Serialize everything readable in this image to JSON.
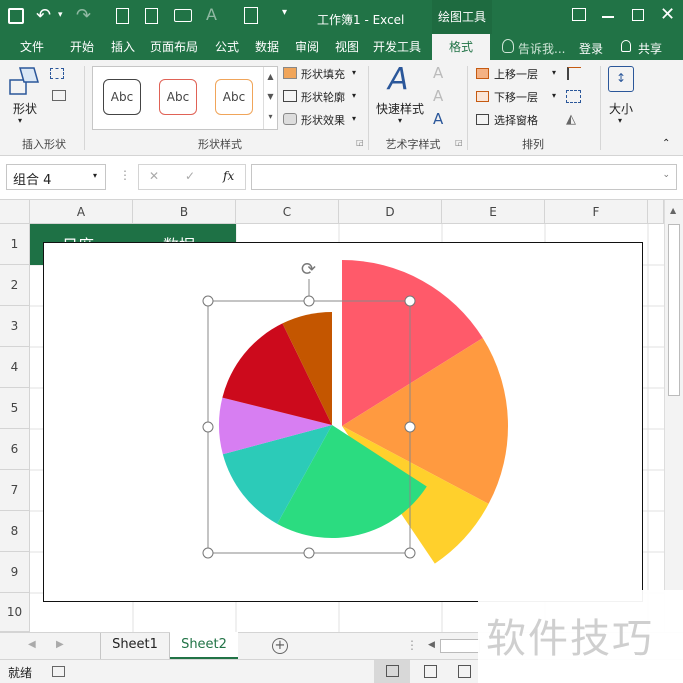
{
  "titlebar": {
    "title": "工作簿1 - Excel",
    "context_tab": "绘图工具"
  },
  "tabs": [
    "文件",
    "开始",
    "插入",
    "页面布局",
    "公式",
    "数据",
    "审阅",
    "视图",
    "开发工具",
    "格式"
  ],
  "tell_me": "告诉我...",
  "login": "登录",
  "share": "共享",
  "ribbon": {
    "insert_shapes": {
      "shape_label": "形状",
      "group": "插入形状"
    },
    "shape_styles": {
      "samples": [
        "Abc",
        "Abc",
        "Abc"
      ],
      "fill": "形状填充",
      "outline": "形状轮廓",
      "effect": "形状效果",
      "group": "形状样式"
    },
    "wordart": {
      "quick": "快速样式",
      "group": "艺术字样式"
    },
    "arrange": {
      "forward": "上移一层",
      "backward": "下移一层",
      "pane": "选择窗格",
      "group": "排列"
    },
    "size": {
      "label": "大小"
    }
  },
  "formula_bar": {
    "name_box": "组合 4",
    "fx": "fx",
    "cancel": "✕",
    "enter": "✓"
  },
  "columns": [
    "A",
    "B",
    "C",
    "D",
    "E",
    "F"
  ],
  "rows": [
    "1",
    "2",
    "3",
    "4",
    "5",
    "6",
    "7",
    "8",
    "9",
    "10"
  ],
  "cells": {
    "a1": "日度",
    "b1": "数据"
  },
  "sheets": [
    "Sheet1",
    "Sheet2"
  ],
  "status": {
    "ready": "就绪"
  },
  "watermark": "软件技巧",
  "chart_data": {
    "type": "pie",
    "slices": [
      {
        "color": "#ff5a6a"
      },
      {
        "color": "#ff9a40"
      },
      {
        "color": "#ffd02c"
      },
      {
        "color": "#2bdc80"
      },
      {
        "color": "#2ccbb8"
      },
      {
        "color": "#d77ef2"
      },
      {
        "color": "#cc0a1c"
      },
      {
        "color": "#c45600"
      }
    ]
  },
  "colors": {
    "excel_green": "#217346",
    "header_gray": "#f3f3f3"
  }
}
